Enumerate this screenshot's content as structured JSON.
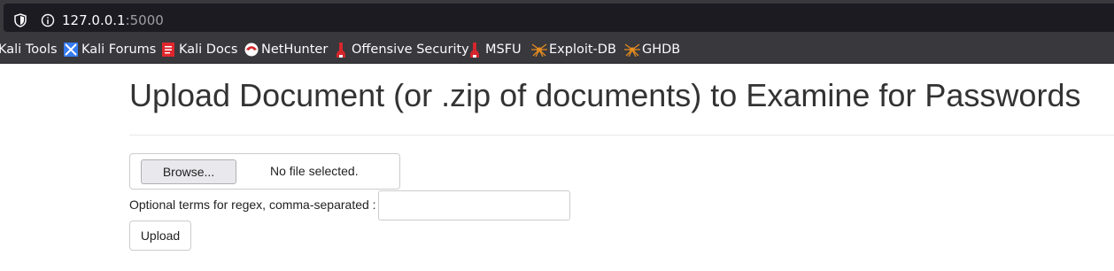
{
  "browser": {
    "url_host": "127.0.0.1",
    "url_port": ":5000",
    "bookmarks": [
      {
        "label": "Kali Tools",
        "icon": "kali-tools-icon"
      },
      {
        "label": "Kali Forums",
        "icon": "kali-forums-icon"
      },
      {
        "label": "Kali Docs",
        "icon": "kali-docs-icon"
      },
      {
        "label": "NetHunter",
        "icon": "nethunter-icon"
      },
      {
        "label": "Offensive Security",
        "icon": "offsec-icon"
      },
      {
        "label": "MSFU",
        "icon": "msfu-icon"
      },
      {
        "label": "Exploit-DB",
        "icon": "exploit-db-icon"
      },
      {
        "label": "GHDB",
        "icon": "ghdb-icon"
      }
    ]
  },
  "page": {
    "title": "Upload Document (or .zip of documents) to Examine for Passwords",
    "file_input": {
      "button_label": "Browse...",
      "status": "No file selected."
    },
    "regex_label": "Optional terms for regex, comma-separated :",
    "regex_value": "",
    "upload_label": "Upload"
  }
}
